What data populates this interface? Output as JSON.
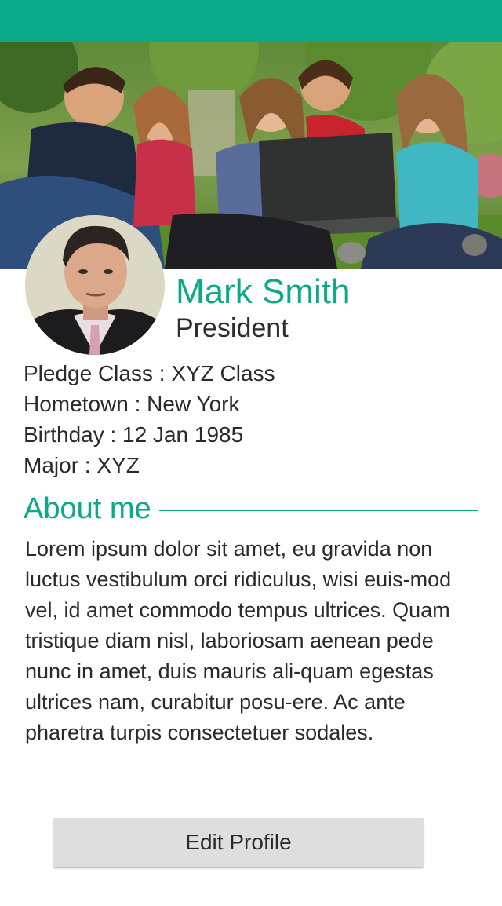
{
  "colors": {
    "accent": "#0aa989",
    "text": "#2a2a2a",
    "button_bg": "#dedede"
  },
  "header": {
    "cover_image": "group-of-students-with-laptop-photo"
  },
  "profile": {
    "avatar_image": "portrait-photo",
    "name": "Mark Smith",
    "role": "President",
    "details": [
      "Pledge Class : XYZ Class",
      "Hometown : New York",
      "Birthday : 12 Jan 1985",
      "Major : XYZ"
    ]
  },
  "about": {
    "title": "About me",
    "text": "Lorem ipsum dolor sit amet, eu gravida non luctus vestibulum orci ridiculus, wisi euis-mod vel, id amet commodo tempus ultrices. Quam tristique diam nisl, laboriosam aenean pede nunc in amet, duis mauris ali-quam egestas ultrices nam, curabitur posu-ere. Ac ante pharetra turpis consectetuer sodales."
  },
  "actions": {
    "edit_label": "Edit Profile"
  }
}
